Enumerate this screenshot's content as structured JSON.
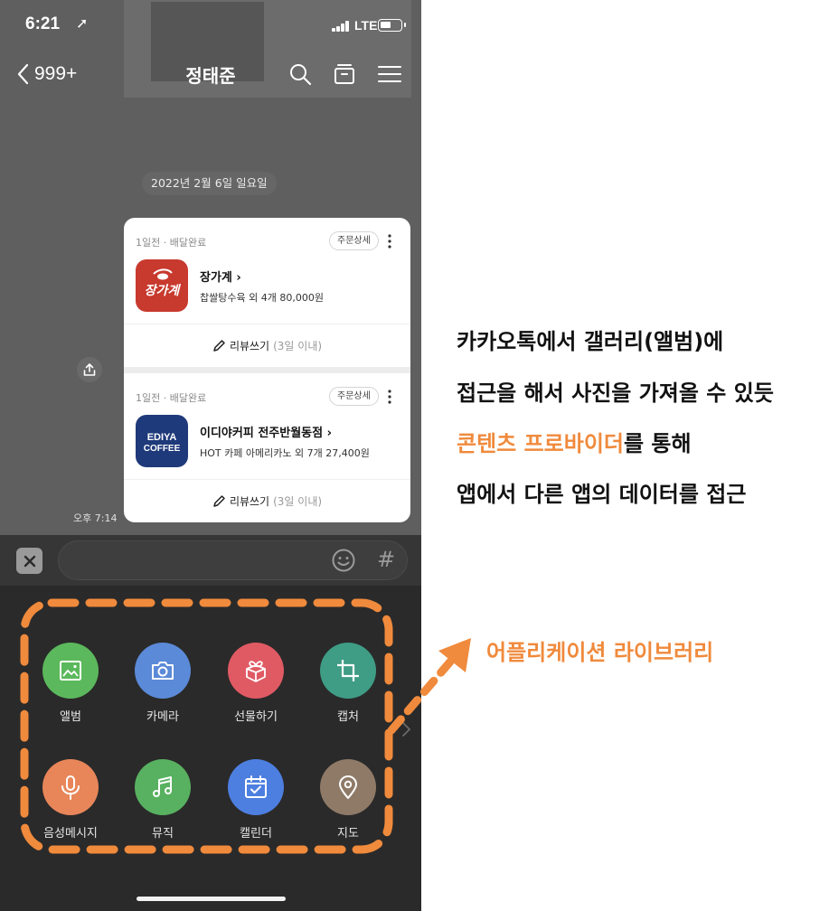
{
  "status_bar": {
    "time": "6:21",
    "location_glyph": "➚",
    "network": "LTE"
  },
  "header": {
    "back_label": "999+",
    "title": "정태준"
  },
  "chat": {
    "date_divider": "2022년 2월 6일 일요일",
    "message_time": "오후 7:14",
    "orders": [
      {
        "meta": "1일전 · 배달완료",
        "detail_button": "주문상세",
        "shop": "장가계 ›",
        "logo_text": "장가계",
        "items": "찹쌀탕수육 외 4개 80,000원",
        "review_label": "리뷰쓰기",
        "review_note": "(3일 이내)"
      },
      {
        "meta": "1일전 · 배달완료",
        "detail_button": "주문상세",
        "shop": "이디야커피 전주반월동점 ›",
        "logo_line1": "EDIYA",
        "logo_line2": "COFFEE",
        "items": "HOT 카페 아메리카노 외 7개 27,400원",
        "review_label": "리뷰쓰기",
        "review_note": "(3일 이내)"
      }
    ]
  },
  "input": {
    "hash": "#"
  },
  "drawer": {
    "apps": [
      {
        "label": "앨범",
        "icon": "album-icon",
        "color": "#5cb85c"
      },
      {
        "label": "카메라",
        "icon": "camera-icon",
        "color": "#5b8ad8"
      },
      {
        "label": "선물하기",
        "icon": "gift-icon",
        "color": "#e05a64"
      },
      {
        "label": "캡처",
        "icon": "crop-icon",
        "color": "#3f9c85"
      },
      {
        "label": "음성메시지",
        "icon": "microphone-icon",
        "color": "#e8865a"
      },
      {
        "label": "뮤직",
        "icon": "music-icon",
        "color": "#58b160"
      },
      {
        "label": "캘린더",
        "icon": "calendar-icon",
        "color": "#4d7fe0"
      },
      {
        "label": "지도",
        "icon": "map-pin-icon",
        "color": "#8f7a68"
      }
    ]
  },
  "annotations": {
    "line1": "카카오톡에서 갤러리(앨범)에",
    "line2": "접근을 해서 사진을 가져올 수 있듯",
    "line3_highlight": "콘텐츠 프로바이더",
    "line3_rest": "를 통해",
    "line4": "앱에서 다른 앱의 데이터를 접근",
    "library_label": "어플리케이션 라이브러리"
  },
  "colors": {
    "accent_orange": "#f08a3c",
    "card_bg": "#ffffff",
    "drawer_bg": "#2a2a2a"
  }
}
